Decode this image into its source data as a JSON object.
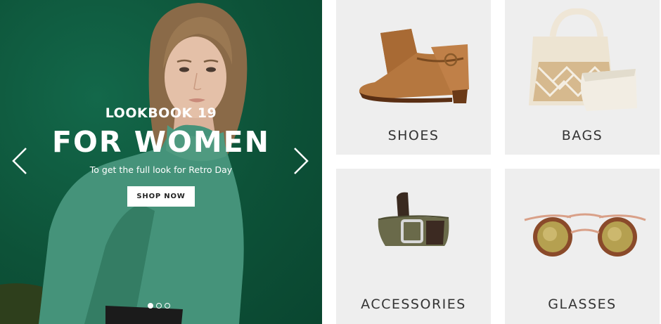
{
  "hero": {
    "kicker": "LOOKBOOK 19",
    "title": "FOR WOMEN",
    "subtitle": "To get the full look for Retro Day",
    "button_label": "SHOP NOW",
    "slides_total": 3,
    "active_slide": 1,
    "background_color": "#0f5a3f"
  },
  "categories": [
    {
      "label": "SHOES",
      "icon": "ankle-boot-image"
    },
    {
      "label": "BAGS",
      "icon": "tote-bag-image"
    },
    {
      "label": "ACCESSORIES",
      "icon": "belt-image"
    },
    {
      "label": "GLASSES",
      "icon": "sunglasses-image"
    }
  ]
}
